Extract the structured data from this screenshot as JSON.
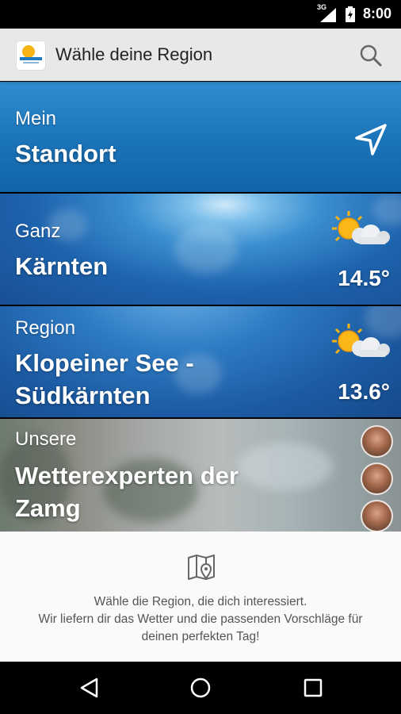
{
  "status_bar": {
    "network": "3G",
    "time": "8:00"
  },
  "app_bar": {
    "title": "Wähle deine Region",
    "search_icon": "search-icon",
    "logo_icon": "app-logo"
  },
  "tiles": [
    {
      "small": "Mein",
      "big": "Standort",
      "icon": "location-arrow-icon"
    },
    {
      "small": "Ganz",
      "big": "Kärnten",
      "temp": "14.5°",
      "icon": "partly-cloudy-icon"
    },
    {
      "small": "Region",
      "big": "Klopeiner See - Südkärnten",
      "temp": "13.6°",
      "icon": "partly-cloudy-icon"
    },
    {
      "small": "Unsere",
      "big": "Wetterexperten der Zamg",
      "icon": "expert-avatars"
    }
  ],
  "info": {
    "icon": "map-pin-icon",
    "line1": "Wähle die Region, die dich interessiert.",
    "line2": "Wir liefern dir das Wetter und die passenden Vorschläge für",
    "line3": "deinen perfekten Tag!"
  },
  "nav": {
    "back": "back-icon",
    "home": "home-icon",
    "recents": "recents-icon"
  },
  "colors": {
    "tile_blue": "#1b73b8",
    "appbar_bg": "#e8e8e8",
    "info_bg": "#fafafa"
  }
}
